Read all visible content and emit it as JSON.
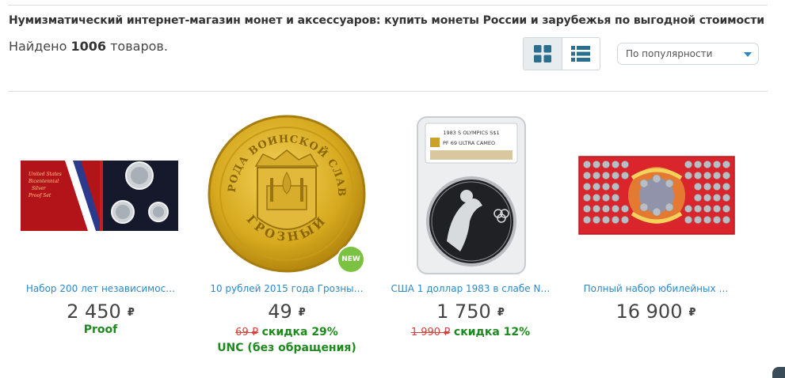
{
  "header": {
    "title": "Нумизматический интернет-магазин монет и аксессуаров: купить монеты России и зарубежья по выгодной стоимости",
    "found_prefix": "Найдено",
    "found_count": "1006",
    "found_suffix": "товаров."
  },
  "view": {
    "active": "grid"
  },
  "sort": {
    "selected": "По популярности"
  },
  "products": [
    {
      "name": "Набор 200 лет независимос…",
      "price": "2 450",
      "currency": "₽",
      "note": "Proof"
    },
    {
      "name": "10 рублей 2015 года Грозны…",
      "price": "49",
      "currency": "₽",
      "old_price": "69 ₽",
      "discount": "скидка 29%",
      "note": "UNC (без обращения)",
      "badge": "NEW",
      "coin_text_top": "ГОРОДА ВОИНСКОЙ СЛАВЫ",
      "coin_text_bottom": "ГРОЗНЫЙ"
    },
    {
      "name": "США 1 доллар 1983 в слабе N…",
      "price": "1 750",
      "currency": "₽",
      "old_price": "1 990 ₽",
      "discount": "скидка 12%",
      "slab_line1": "1983 S OLYMPICS S$1",
      "slab_line2": "PF 69 ULTRA CAMEO"
    },
    {
      "name": "Полный набор юбилейных …",
      "price": "16 900",
      "currency": "₽"
    }
  ],
  "colors": {
    "link": "#2d89c6",
    "green": "#1d8a1d",
    "old_price": "#d9403a",
    "accent": "#2a6f8f"
  }
}
